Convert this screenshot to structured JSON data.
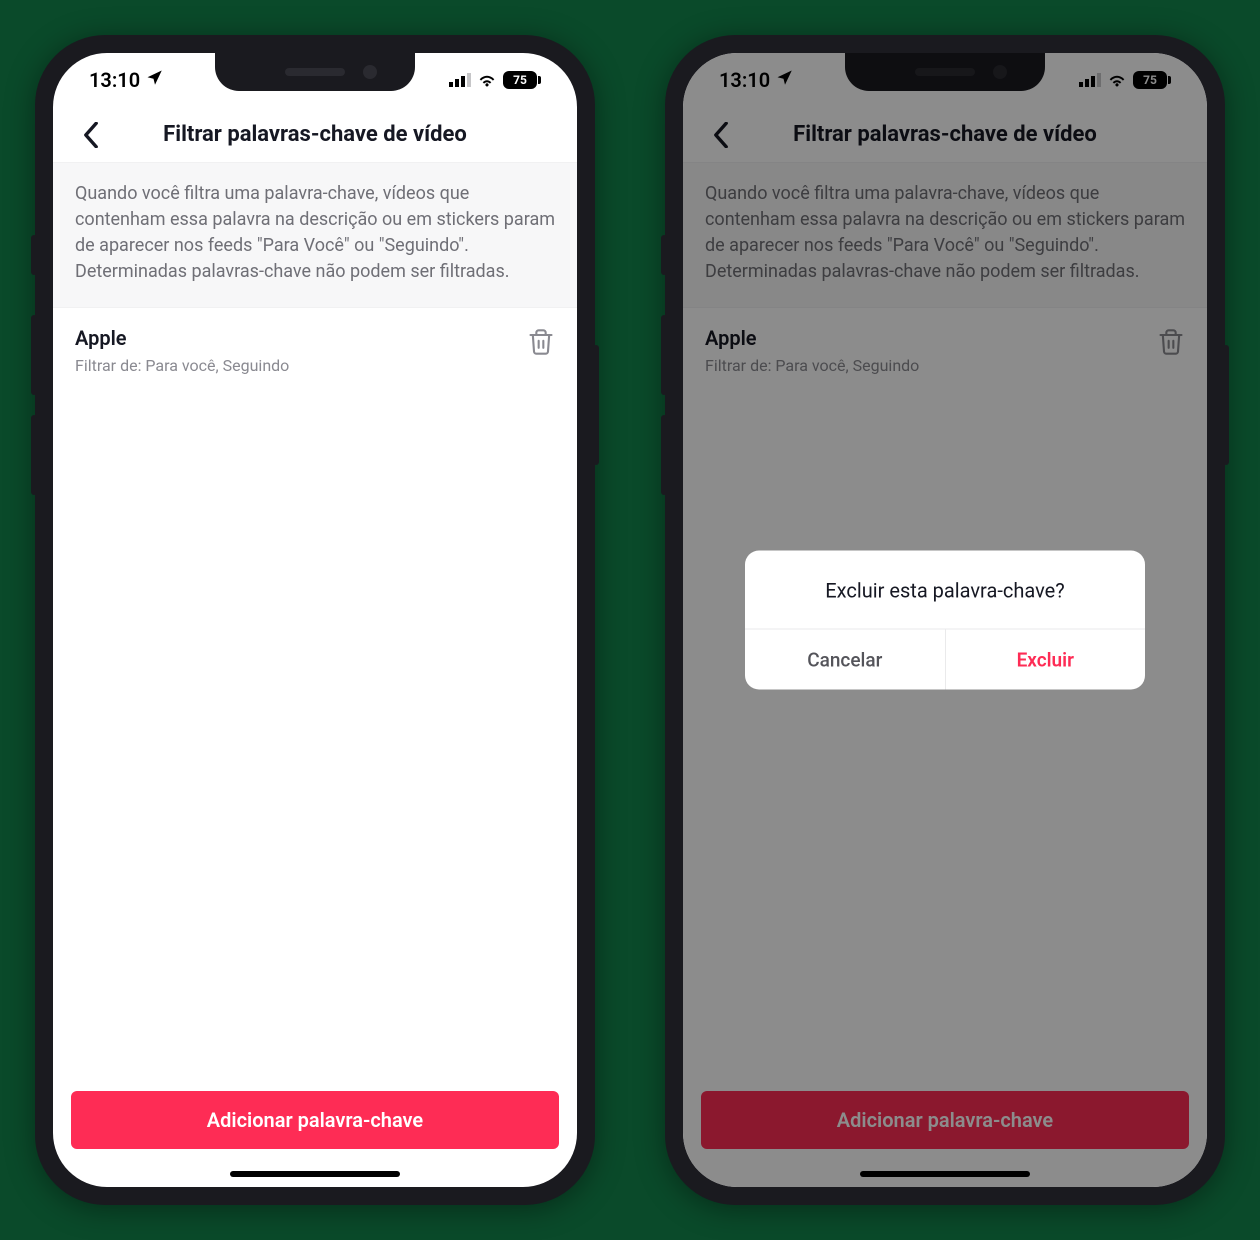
{
  "status": {
    "time": "13:10",
    "battery_pct": "75"
  },
  "nav": {
    "title": "Filtrar palavras-chave de vídeo"
  },
  "info_text": "Quando você filtra uma palavra-chave, vídeos que contenham essa palavra na descrição ou em stickers param de aparecer nos feeds \"Para Você\" ou \"Seguindo\". Determinadas palavras-chave não podem ser filtradas.",
  "keywords": [
    {
      "name": "Apple",
      "sub": "Filtrar de: Para você, Seguindo"
    }
  ],
  "add_button": "Adicionar palavra-chave",
  "dialog": {
    "title": "Excluir esta palavra-chave?",
    "cancel": "Cancelar",
    "confirm": "Excluir"
  }
}
